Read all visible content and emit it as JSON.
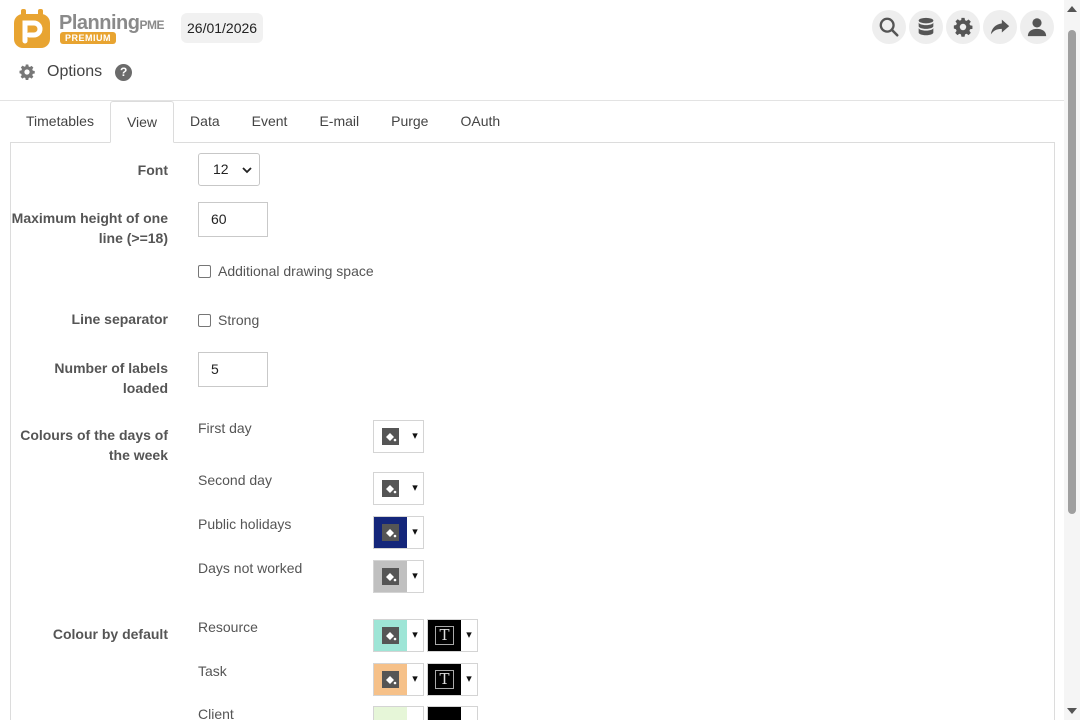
{
  "header": {
    "logo_name": "Planning",
    "logo_suffix": "PME",
    "logo_badge": "PREMIUM",
    "date": "26/01/2026",
    "icons": [
      "search-icon",
      "database-icon",
      "gear-icon",
      "share-icon",
      "user-icon"
    ]
  },
  "page": {
    "title": "Options",
    "help": "?"
  },
  "tabs": [
    {
      "label": "Timetables"
    },
    {
      "label": "View",
      "active": true
    },
    {
      "label": "Data"
    },
    {
      "label": "Event"
    },
    {
      "label": "E-mail"
    },
    {
      "label": "Purge"
    },
    {
      "label": "OAuth"
    }
  ],
  "form": {
    "font": {
      "label": "Font",
      "value": "12"
    },
    "max_height": {
      "label": "Maximum height of one line (>=18)",
      "value": "60"
    },
    "additional_space": {
      "label": "Additional drawing space",
      "checked": false
    },
    "line_separator": {
      "label": "Line separator",
      "option": "Strong",
      "checked": false
    },
    "labels_loaded": {
      "label": "Number of labels loaded",
      "value": "5"
    },
    "day_colours": {
      "label": "Colours of the days of the week",
      "items": [
        {
          "label": "First day",
          "color": "#ffffff"
        },
        {
          "label": "Second day",
          "color": "#ffffff"
        },
        {
          "label": "Public holidays",
          "color": "#14267a"
        },
        {
          "label": "Days not worked",
          "color": "#c0c0c0"
        }
      ]
    },
    "default_colours": {
      "label": "Colour by default",
      "items": [
        {
          "label": "Resource",
          "color": "#9ee5d6",
          "text_color": "#000000"
        },
        {
          "label": "Task",
          "color": "#f6c189",
          "text_color": "#000000"
        },
        {
          "label": "Client",
          "color": "#e6f6d8",
          "text_color": "#000000"
        }
      ]
    }
  },
  "colors": {
    "accent": "#e8a431",
    "dropdown_caret": "▾"
  }
}
